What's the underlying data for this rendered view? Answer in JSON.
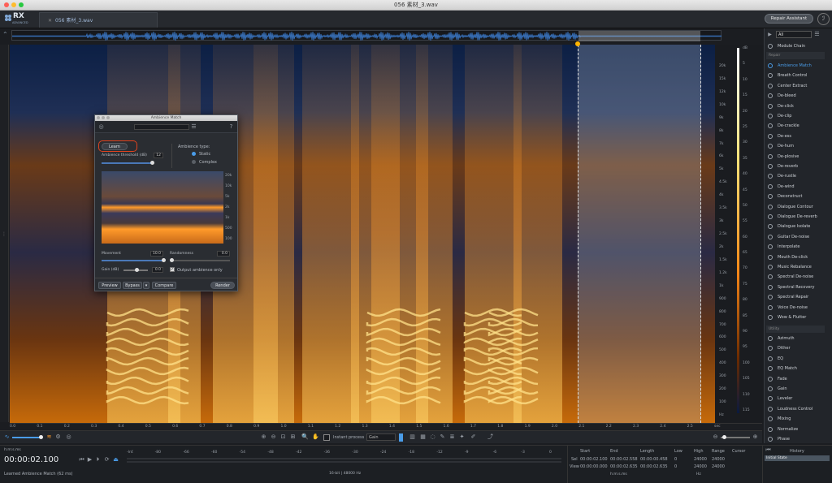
{
  "window": {
    "title": "056 素材_3.wav"
  },
  "app": {
    "logo_text": "RX",
    "logo_sub": "ADVANCED",
    "tab_name": "056 素材_3.wav",
    "repair_assistant": "Repair Assistant"
  },
  "freq_ticks_hz": [
    "20k",
    "15k",
    "12k",
    "10k",
    "9k",
    "8k",
    "7k",
    "6k",
    "5k",
    "4.5k",
    "4k",
    "3.5k",
    "3k",
    "2.5k",
    "2k",
    "1.5k",
    "1.2k",
    "1k",
    "900",
    "800",
    "700",
    "600",
    "500",
    "400",
    "300",
    "200",
    "100",
    "Hz"
  ],
  "db_ticks": [
    "dB",
    "5",
    "10",
    "15",
    "20",
    "25",
    "30",
    "35",
    "40",
    "45",
    "50",
    "55",
    "60",
    "65",
    "70",
    "75",
    "80",
    "85",
    "90",
    "95",
    "100",
    "105",
    "110",
    "115"
  ],
  "time_ticks": [
    "0.0",
    "0.1",
    "0.2",
    "0.3",
    "0.4",
    "0.5",
    "0.6",
    "0.7",
    "0.8",
    "0.9",
    "1.0",
    "1.1",
    "1.2",
    "1.3",
    "1.4",
    "1.5",
    "1.6",
    "1.7",
    "1.8",
    "1.9",
    "2.0",
    "2.1",
    "2.2",
    "2.3",
    "2.4",
    "2.5",
    "sec"
  ],
  "toolbar": {
    "instant_process": "Instant process",
    "gain_mode": "Gain"
  },
  "bottom": {
    "timecode_label": "h:m:s.ms",
    "timecode": "00:00:02.100",
    "status": "Learned Ambience Match (62 ms)",
    "meter_ticks": [
      "-Inf.",
      "-80",
      "-66",
      "-60",
      "-54",
      "-48",
      "-42",
      "-36",
      "-30",
      "-24",
      "-18",
      "-12",
      "-9",
      "-6",
      "-3",
      "0"
    ],
    "format": "16-bit | 48000 Hz",
    "sel_label": "Sel",
    "view_label": "View",
    "start_label": "Start",
    "end_label": "End",
    "length_label": "Length",
    "low_label": "Low",
    "high_label": "High",
    "range_label": "Range",
    "cursor_label": "Cursor",
    "sel_start": "00:00:02.100",
    "sel_end": "00:00:02.558",
    "sel_length": "00:00:00.458",
    "sel_low": "0",
    "sel_high": "24000",
    "sel_range": "24000",
    "view_start": "00:00:00.000",
    "view_end": "00:00:02.635",
    "view_length": "00:00:02.635",
    "view_low": "0",
    "view_high": "24000",
    "view_range": "24000",
    "units_time": "h:m:s.ms",
    "units_hz": "Hz",
    "history_title": "History",
    "history_item": "Initial State"
  },
  "panel": {
    "filter": "All",
    "module_chain": "Module Chain",
    "repair_header": "Repair",
    "repair_modules": [
      "Ambience Match",
      "Breath Control",
      "Center Extract",
      "De-bleed",
      "De-click",
      "De-clip",
      "De-crackle",
      "De-ess",
      "De-hum",
      "De-plosive",
      "De-reverb",
      "De-rustle",
      "De-wind",
      "Deconstruct",
      "Dialogue Contour",
      "Dialogue De-reverb",
      "Dialogue Isolate",
      "Guitar De-noise",
      "Interpolate",
      "Mouth De-click",
      "Music Rebalance",
      "Spectral De-noise",
      "Spectral Recovery",
      "Spectral Repair",
      "Voice De-noise",
      "Wow & Flutter"
    ],
    "utility_header": "Utility",
    "utility_modules": [
      "Azimuth",
      "Dither",
      "EQ",
      "EQ Match",
      "Fade",
      "Gain",
      "Leveler",
      "Loudness Control",
      "Mixing",
      "Normalize",
      "Phase"
    ]
  },
  "dialog": {
    "title": "Ambience Match",
    "learn": "Learn",
    "threshold_label": "Ambience threshold (dB)",
    "threshold_value": "12",
    "type_label": "Ambience type:",
    "static": "Static",
    "complex": "Complex",
    "freq_ticks": [
      "20k",
      "10k",
      "5k",
      "2k",
      "1k",
      "500",
      "100"
    ],
    "movement_label": "Movement",
    "movement_value": "10.0",
    "randomness_label": "Randomness",
    "randomness_value": "0.0",
    "gain_label": "Gain (dB)",
    "gain_value": "0.0",
    "output_only": "Output ambience only",
    "preview": "Preview",
    "bypass": "Bypass",
    "compare": "Compare",
    "render": "Render"
  },
  "colors": {
    "accent": "#4a9ce8",
    "highlight_ring": "#e0431f",
    "spectrum_hot": "#ffb43a"
  }
}
